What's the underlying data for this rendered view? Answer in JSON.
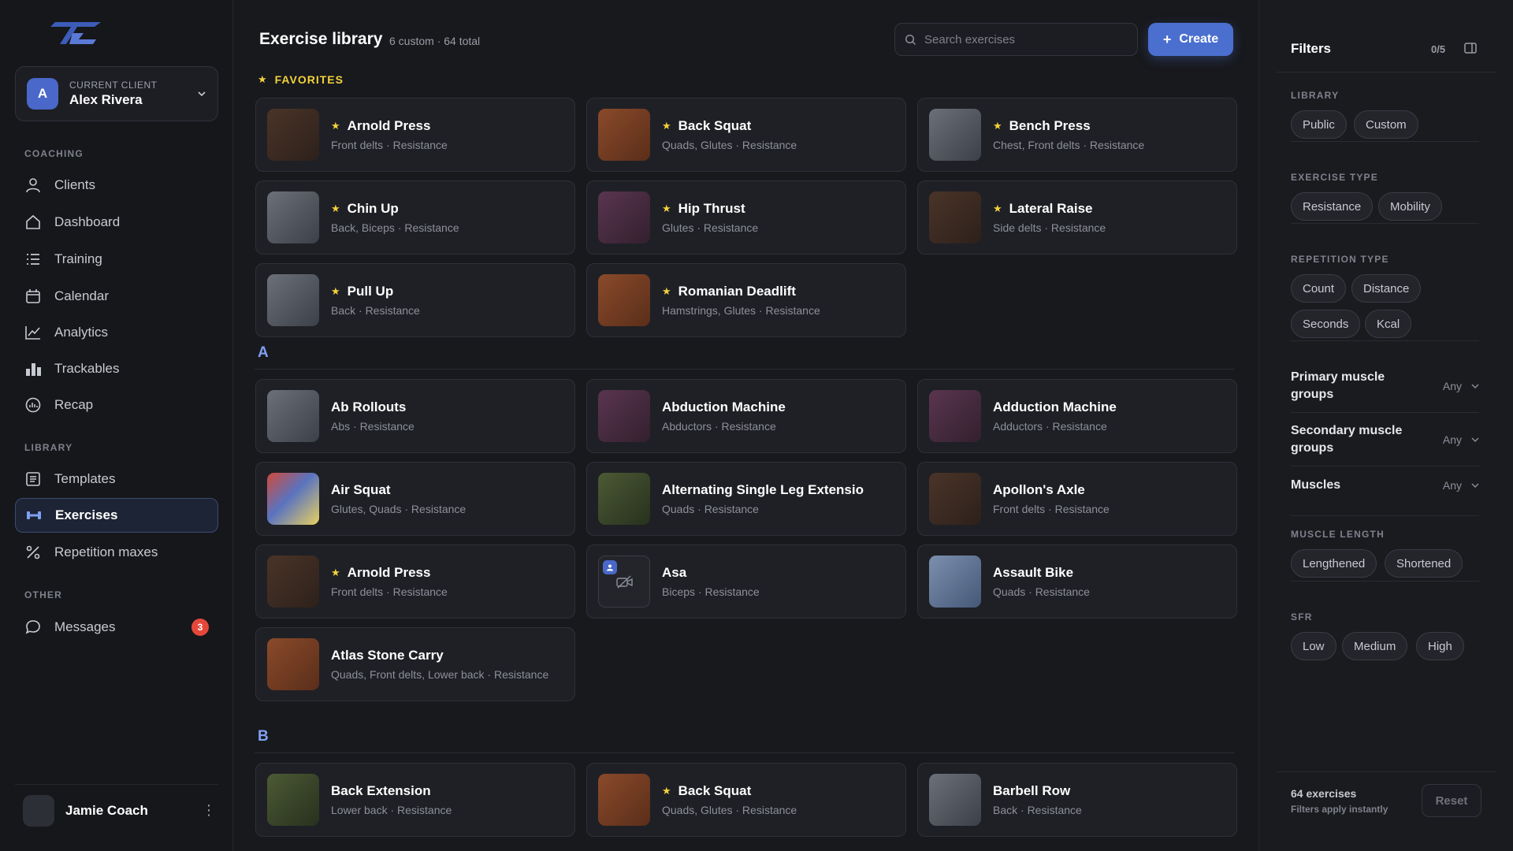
{
  "sidebar": {
    "client_caption": "CURRENT CLIENT",
    "client_initial": "A",
    "client_name": "Alex Rivera",
    "sections": {
      "coaching": "COACHING",
      "library": "LIBRARY",
      "other": "OTHER"
    },
    "items": [
      {
        "label": "Clients",
        "icon": "person-icon"
      },
      {
        "label": "Dashboard",
        "icon": "home-icon"
      },
      {
        "label": "Training",
        "icon": "list-icon"
      },
      {
        "label": "Calendar",
        "icon": "calendar-icon"
      },
      {
        "label": "Analytics",
        "icon": "chart-line-icon"
      },
      {
        "label": "Trackables",
        "icon": "bar-chart-icon"
      },
      {
        "label": "Recap",
        "icon": "gauge-icon"
      },
      {
        "label": "Templates",
        "icon": "document-icon"
      },
      {
        "label": "Exercises",
        "icon": "dumbbell-icon",
        "active": true
      },
      {
        "label": "Repetition maxes",
        "icon": "percent-icon"
      },
      {
        "label": "Messages",
        "icon": "chat-icon",
        "badge": "3"
      }
    ],
    "user_name": "Jamie Coach"
  },
  "header": {
    "title": "Exercise library",
    "subtitle": "6 custom · 64 total",
    "search_placeholder": "Search exercises",
    "create_label": "Create"
  },
  "favorites": {
    "heading": "FAVORITES",
    "cards": [
      {
        "name": "Arnold Press",
        "sub": "Front delts · Resistance",
        "thumb": "brown"
      },
      {
        "name": "Back Squat",
        "sub": "Quads, Glutes · Resistance",
        "thumb": "orange"
      },
      {
        "name": "Bench Press",
        "sub": "Chest, Front delts · Resistance",
        "thumb": "gray"
      },
      {
        "name": "Chin Up",
        "sub": "Back, Biceps · Resistance",
        "thumb": "gray"
      },
      {
        "name": "Hip Thrust",
        "sub": "Glutes · Resistance",
        "thumb": "purple"
      },
      {
        "name": "Lateral Raise",
        "sub": "Side delts · Resistance",
        "thumb": "brown"
      },
      {
        "name": "Pull Up",
        "sub": "Back · Resistance",
        "thumb": "gray"
      },
      {
        "name": "Romanian Deadlift",
        "sub": "Hamstrings, Glutes · Resistance",
        "thumb": "orange"
      }
    ]
  },
  "group_a": {
    "letter": "A",
    "cards": [
      {
        "name": "Ab Rollouts",
        "sub": "Abs · Resistance",
        "thumb": "gray"
      },
      {
        "name": "Abduction Machine",
        "sub": "Abductors · Resistance",
        "thumb": "purple"
      },
      {
        "name": "Adduction Machine",
        "sub": "Adductors · Resistance",
        "thumb": "purple"
      },
      {
        "name": "Air Squat",
        "sub": "Glutes, Quads · Resistance",
        "thumb": "multi"
      },
      {
        "name": "Alternating Single Leg Extensio",
        "sub": "Quads · Resistance",
        "thumb": "green"
      },
      {
        "name": "Apollon's Axle",
        "sub": "Front delts · Resistance",
        "thumb": "brown"
      },
      {
        "name": "Arnold Press",
        "sub": "Front delts · Resistance",
        "thumb": "brown",
        "fav": true
      },
      {
        "name": "Asa",
        "sub": "Biceps · Resistance",
        "thumb": "empty"
      },
      {
        "name": "Assault Bike",
        "sub": "Quads · Resistance",
        "thumb": "blue"
      },
      {
        "name": "Atlas Stone Carry",
        "sub": "Quads, Front delts, Lower back · Resistance",
        "thumb": "orange"
      }
    ]
  },
  "group_b": {
    "letter": "B",
    "cards": [
      {
        "name": "Back Extension",
        "sub": "Lower back · Resistance",
        "thumb": "green"
      },
      {
        "name": "Back Squat",
        "sub": "Quads, Glutes · Resistance",
        "thumb": "orange",
        "fav": true
      },
      {
        "name": "Barbell Row",
        "sub": "Back · Resistance",
        "thumb": "gray"
      }
    ]
  },
  "filters": {
    "title": "Filters",
    "count": "0/5",
    "library_label": "LIBRARY",
    "library_chips": [
      "Public",
      "Custom"
    ],
    "exercise_type_label": "EXERCISE TYPE",
    "exercise_type_chips": [
      "Resistance",
      "Mobility"
    ],
    "repetition_type_label": "REPETITION TYPE",
    "repetition_type_chips": [
      "Count",
      "Distance",
      "Seconds",
      "Kcal"
    ],
    "dropdowns": [
      {
        "label": "Primary muscle groups",
        "value": "Any"
      },
      {
        "label": "Secondary muscle groups",
        "value": "Any"
      },
      {
        "label": "Muscles",
        "value": "Any"
      }
    ],
    "muscle_length_label": "MUSCLE LENGTH",
    "muscle_length_chips": [
      "Lengthened",
      "Shortened"
    ],
    "sfr_label": "SFR",
    "sfr_chips": [
      "Low",
      "Medium",
      "High"
    ],
    "result_count": "64 exercises",
    "result_note": "Filters apply instantly",
    "reset_label": "Reset"
  },
  "colors": {
    "accent": "#4a6fcf",
    "favorite": "#f2d23c",
    "letter": "#7fa0f2",
    "badge": "#e5483b"
  }
}
